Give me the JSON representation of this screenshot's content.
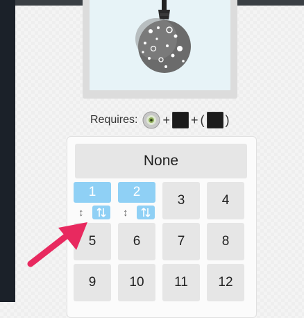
{
  "requires": {
    "label": "Requires:",
    "plus1": "+",
    "plus2": "+",
    "open_paren": "(",
    "close_paren": ")"
  },
  "selector": {
    "none_label": "None",
    "selected": [
      {
        "label": "1"
      },
      {
        "label": "2"
      }
    ],
    "cells": [
      "3",
      "4",
      "5",
      "6",
      "7",
      "8",
      "9",
      "10",
      "11",
      "12"
    ]
  },
  "colors": {
    "accent": "#8fd0f5",
    "pointer": "#e8295f",
    "sidebar": "#1b2129"
  },
  "icons": {
    "move": "updown-arrow-icon",
    "swap": "swap-icon",
    "requirement_1": "eye-gem-icon"
  }
}
